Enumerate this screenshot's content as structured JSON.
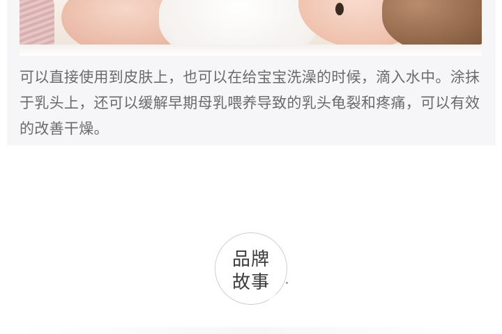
{
  "product_section": {
    "photo_icon": "baby-photo",
    "description": "可以直接使用到皮肤上，也可以在给宝宝洗澡的时候，滴入水中。涂抹于乳头上，还可以缓解早期母乳喂养导致的乳头龟裂和疼痛，可以有效的改善干燥。"
  },
  "brand_badge": {
    "line1": "品牌",
    "line2": "故事"
  },
  "colors": {
    "card_background": "#f6f6f8",
    "body_text": "#6a6a6a",
    "badge_text": "#3a3a3a",
    "badge_border": "#cfcfcf"
  }
}
